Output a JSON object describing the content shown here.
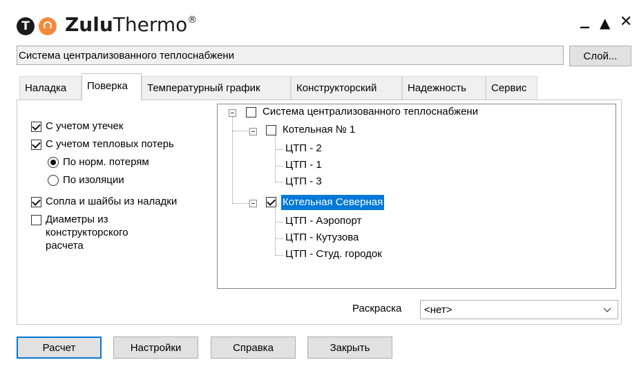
{
  "app": {
    "title_bold": "Zulu",
    "title_rest": "Thermo",
    "trademark": "®",
    "logo_letter": "T",
    "minimize": "_",
    "maximize": "▲",
    "close": "✕"
  },
  "header": {
    "system_name": "Система централизованного теплоснабжени",
    "layer_button": "Слой..."
  },
  "tabs": [
    {
      "label": "Наладка"
    },
    {
      "label": "Поверка"
    },
    {
      "label": "Температурный график"
    },
    {
      "label": "Конструкторский"
    },
    {
      "label": "Надежность"
    },
    {
      "label": "Сервис"
    }
  ],
  "active_tab": "Поверка",
  "options": {
    "leaks": {
      "label": "С учетом утечек",
      "checked": true
    },
    "heat_losses": {
      "label": "С учетом тепловых потерь",
      "checked": true
    },
    "radio_norm": {
      "label": "По норм. потерям",
      "checked": true
    },
    "radio_insulation": {
      "label": "По изоляции",
      "checked": false
    },
    "nozzles": {
      "label": "Сопла и шайбы из наладки",
      "checked": true
    },
    "diameters": {
      "label_lines": [
        "Диаметры из",
        "конструкторского",
        "расчета"
      ],
      "checked": false
    }
  },
  "tree": {
    "root": {
      "label": "Система централизованного теплоснабжени",
      "checked": false
    },
    "boiler1": {
      "label": "Котельная № 1",
      "checked": false,
      "children": [
        "ЦТП - 2",
        "ЦТП - 1",
        "ЦТП - 3"
      ]
    },
    "boiler2": {
      "label": "Котельная Северная",
      "checked": true,
      "selected": true,
      "children": [
        "ЦТП - Аэропорт",
        "ЦТП - Кутузова",
        "ЦТП - Студ. городок"
      ]
    }
  },
  "coloring": {
    "label": "Раскраска",
    "value": "<нет>"
  },
  "buttons": {
    "calculate": "Расчет",
    "settings": "Настройки",
    "help": "Справка",
    "close": "Закрыть"
  },
  "colors": {
    "selection": "#0078d7",
    "logo_orange": "#f08a3c"
  }
}
